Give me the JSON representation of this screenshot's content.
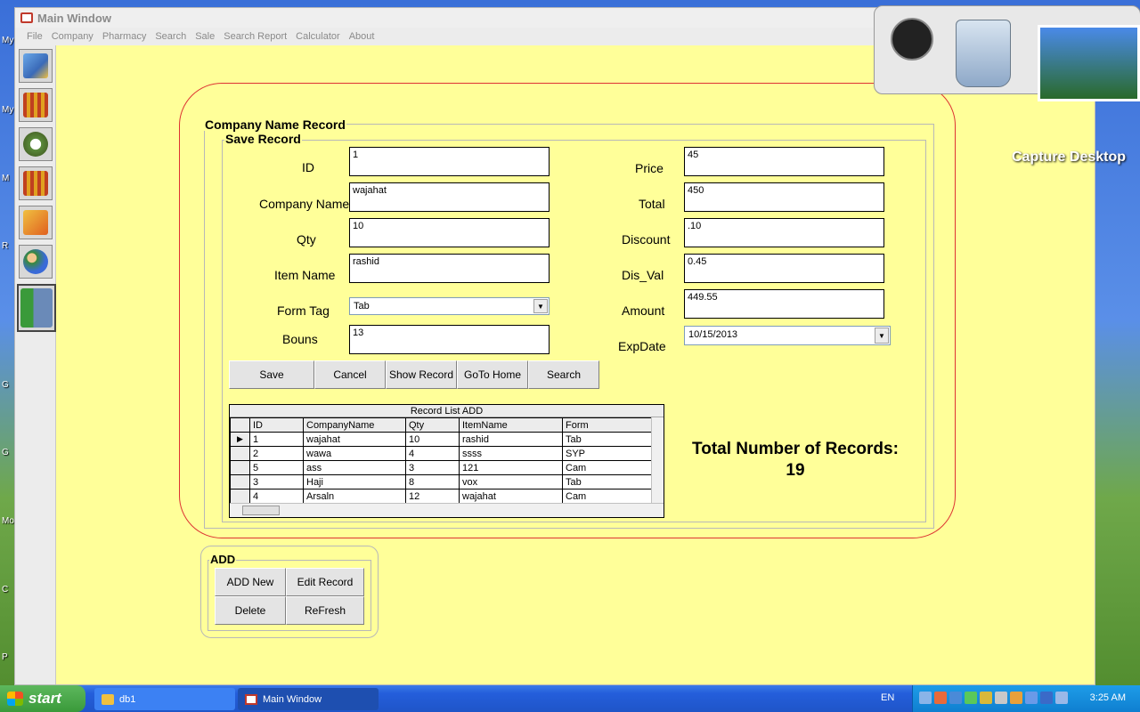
{
  "window": {
    "title": "Main Window"
  },
  "menu": [
    "File",
    "Company",
    "Pharmacy",
    "Search",
    "Sale",
    "Search Report",
    "Calculator",
    "About"
  ],
  "groups": {
    "outer_title": "Company Name Record",
    "inner_title": "Save  Record",
    "add_title": "ADD"
  },
  "form": {
    "id_label": "ID",
    "id_value": "1",
    "company_label": "Company Name",
    "company_value": "wajahat",
    "qty_label": "Qty",
    "qty_value": "10",
    "item_label": "Item Name",
    "item_value": "rashid",
    "formtag_label": "Form Tag",
    "formtag_value": "Tab",
    "bouns_label": "Bouns",
    "bouns_value": "13",
    "price_label": "Price",
    "price_value": "45",
    "total_label": "Total",
    "total_value": "450",
    "discount_label": "Discount",
    "discount_value": ".10",
    "disval_label": "Dis_Val",
    "disval_value": "0.45",
    "amount_label": "Amount",
    "amount_value": "449.55",
    "expdate_label": "ExpDate",
    "expdate_value": "10/15/2013"
  },
  "buttons": {
    "save": "Save",
    "cancel": "Cancel",
    "show": "Show Record",
    "home": "GoTo Home",
    "search": "Search",
    "add_new": "ADD New",
    "edit": "Edit Record",
    "delete": "Delete",
    "refresh": "ReFresh"
  },
  "grid": {
    "caption": "Record List  ADD",
    "columns": [
      "ID",
      "CompanyName",
      "Qty",
      "ItemName",
      "Form"
    ],
    "rows": [
      [
        "1",
        "wajahat",
        "10",
        "rashid",
        "Tab"
      ],
      [
        "2",
        "wawa",
        "4",
        "ssss",
        "SYP"
      ],
      [
        "5",
        "ass",
        "3",
        "121",
        "Cam"
      ],
      [
        "3",
        "Haji",
        "8",
        "vox",
        "Tab"
      ],
      [
        "4",
        "Arsaln",
        "12",
        "wajahat",
        "Cam"
      ]
    ]
  },
  "summary": {
    "label": "Total Number of Records:",
    "count": "19"
  },
  "desktop": {
    "capture_label": "Capture Desktop",
    "edge_labels": [
      "My",
      "My",
      "M",
      "R",
      "G",
      "G",
      "Mo",
      "C",
      "P"
    ]
  },
  "taskbar": {
    "start": "start",
    "items": [
      "db1",
      "Main Window"
    ],
    "lang": "EN",
    "time": "3:25 AM"
  }
}
